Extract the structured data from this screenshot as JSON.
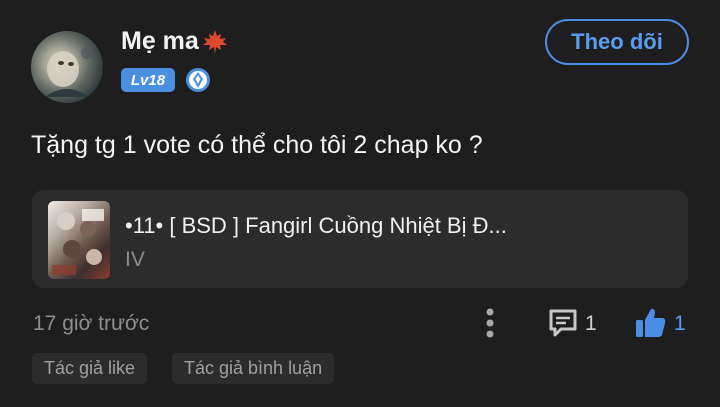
{
  "user": {
    "name": "Mẹ ma",
    "name_icon": "maple-leaf-icon",
    "level": "Lv18",
    "rank_icon": "diamond-rank-icon"
  },
  "follow_button": {
    "label": "Theo dõi"
  },
  "comment": {
    "text": "Tặng tg 1 vote có thể cho tôi 2 chap ko ?"
  },
  "story_card": {
    "title": "•11• [ BSD ] Fangirl Cuồng Nhiệt Bị Đ...",
    "subtitle": "IV"
  },
  "footer": {
    "timestamp": "17 giờ trước",
    "reply_count": "1",
    "like_count": "1"
  },
  "tags": [
    {
      "label": "Tác giả like"
    },
    {
      "label": "Tác giả bình luận"
    }
  ],
  "colors": {
    "background": "#1e1e1e",
    "accent": "#4b8ee6",
    "card": "#2c2c2c",
    "leaf": "#e0472f"
  }
}
